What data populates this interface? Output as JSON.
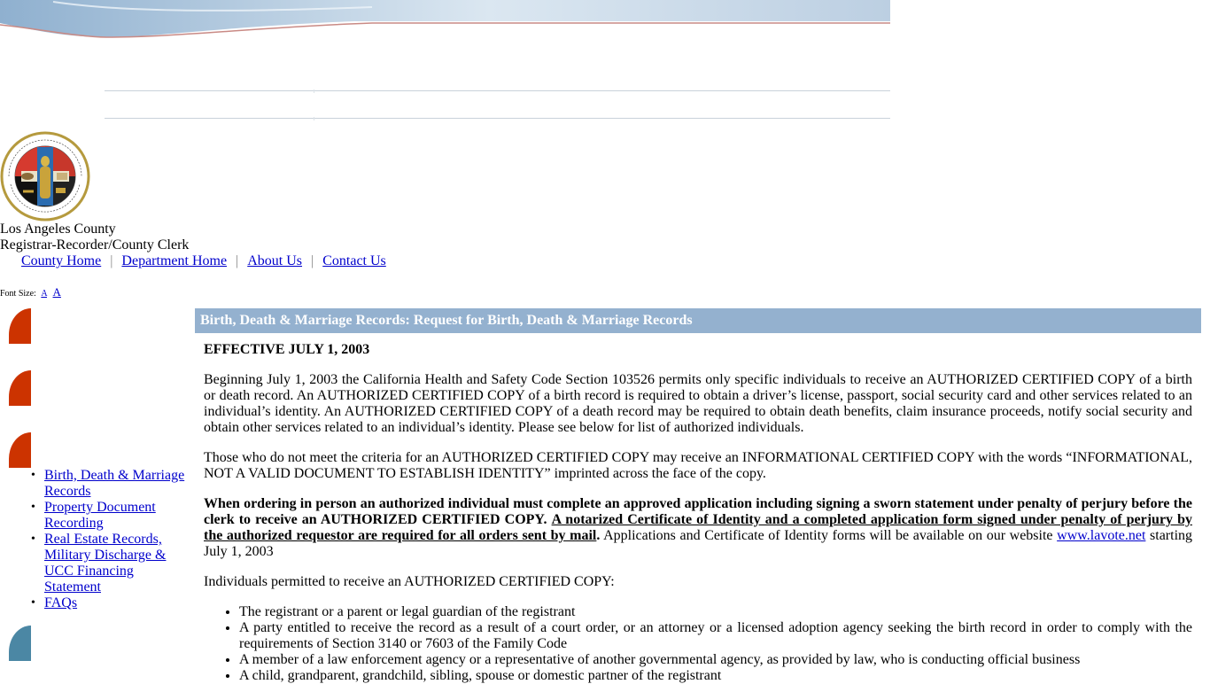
{
  "header": {
    "org_line1": "Los Angeles County",
    "org_line2": "Registrar-Recorder/County Clerk",
    "seal_alt": "Registrar-Recorder/County Clerk - County of Los Angeles - California seal"
  },
  "top_nav": [
    {
      "label": "County Home"
    },
    {
      "label": "Department Home"
    },
    {
      "label": "About Us"
    },
    {
      "label": "Contact Us"
    }
  ],
  "top_nav_separator": "|",
  "font_size": {
    "label": "Font Size:",
    "small": "A",
    "large": "A"
  },
  "sidebar": {
    "tab_colors": [
      "#cc3300",
      "#cc3300",
      "#cc3300",
      "#4b87a4"
    ],
    "items": [
      {
        "label": "Birth, Death & Marriage Records"
      },
      {
        "label": "Property Document Recording"
      },
      {
        "label": "Real Estate Records, Military Discharge & UCC Financing Statement"
      },
      {
        "label": "FAQs"
      }
    ]
  },
  "main": {
    "title": "Birth, Death & Marriage Records: Request for Birth, Death & Marriage Records",
    "title_bg": "#94b1cf",
    "effective": "EFFECTIVE JULY 1, 2003",
    "para1": "Beginning July 1, 2003 the California Health and Safety Code Section 103526 permits only specific individuals to receive an AUTHORIZED CERTIFIED COPY of a birth or death record. An AUTHORIZED CERTIFIED COPY of a birth record is required to obtain a driver’s license, passport, social security card and other services related to an individual’s identity. An AUTHORIZED CERTIFIED COPY of a death record may be required to obtain death benefits, claim insurance proceeds, notify social security and obtain other services related to an individual’s identity. Please see below for list of authorized individuals.",
    "para2": "Those who do not meet the criteria for an AUTHORIZED CERTIFIED COPY may receive an INFORMATIONAL CERTIFIED COPY with the words “INFORMATIONAL, NOT A VALID DOCUMENT TO ESTABLISH IDENTITY” imprinted across the face of the copy.",
    "para3_bold": "When ordering in person an authorized individual must complete an approved application including signing a sworn statement under penalty of perjury before the clerk to receive an AUTHORIZED CERTIFIED COPY.",
    "para3_underlined": "A notarized Certificate of Identity and a completed application form signed under penalty of perjury by the authorized requestor are required for all orders sent by mail",
    "para3_period": ".",
    "para3_rest": "Applications and Certificate of Identity forms will be available on our website",
    "para3_link": "www.lavote.net",
    "para3_end": "starting July 1, 2003",
    "list_intro": "Individuals permitted to receive an AUTHORIZED CERTIFIED COPY:",
    "authorized_list": [
      "The registrant or a parent or legal guardian of the registrant",
      "A party entitled to receive the record as a result of a court order, or an attorney or a licensed adoption agency seeking the birth record in order to comply with the requirements of Section 3140 or 7603 of the Family Code",
      "A member of a law enforcement agency or a representative of another governmental agency, as provided by law, who is conducting official business",
      "A child, grandparent, grandchild, sibling, spouse or domestic partner of the registrant"
    ]
  }
}
